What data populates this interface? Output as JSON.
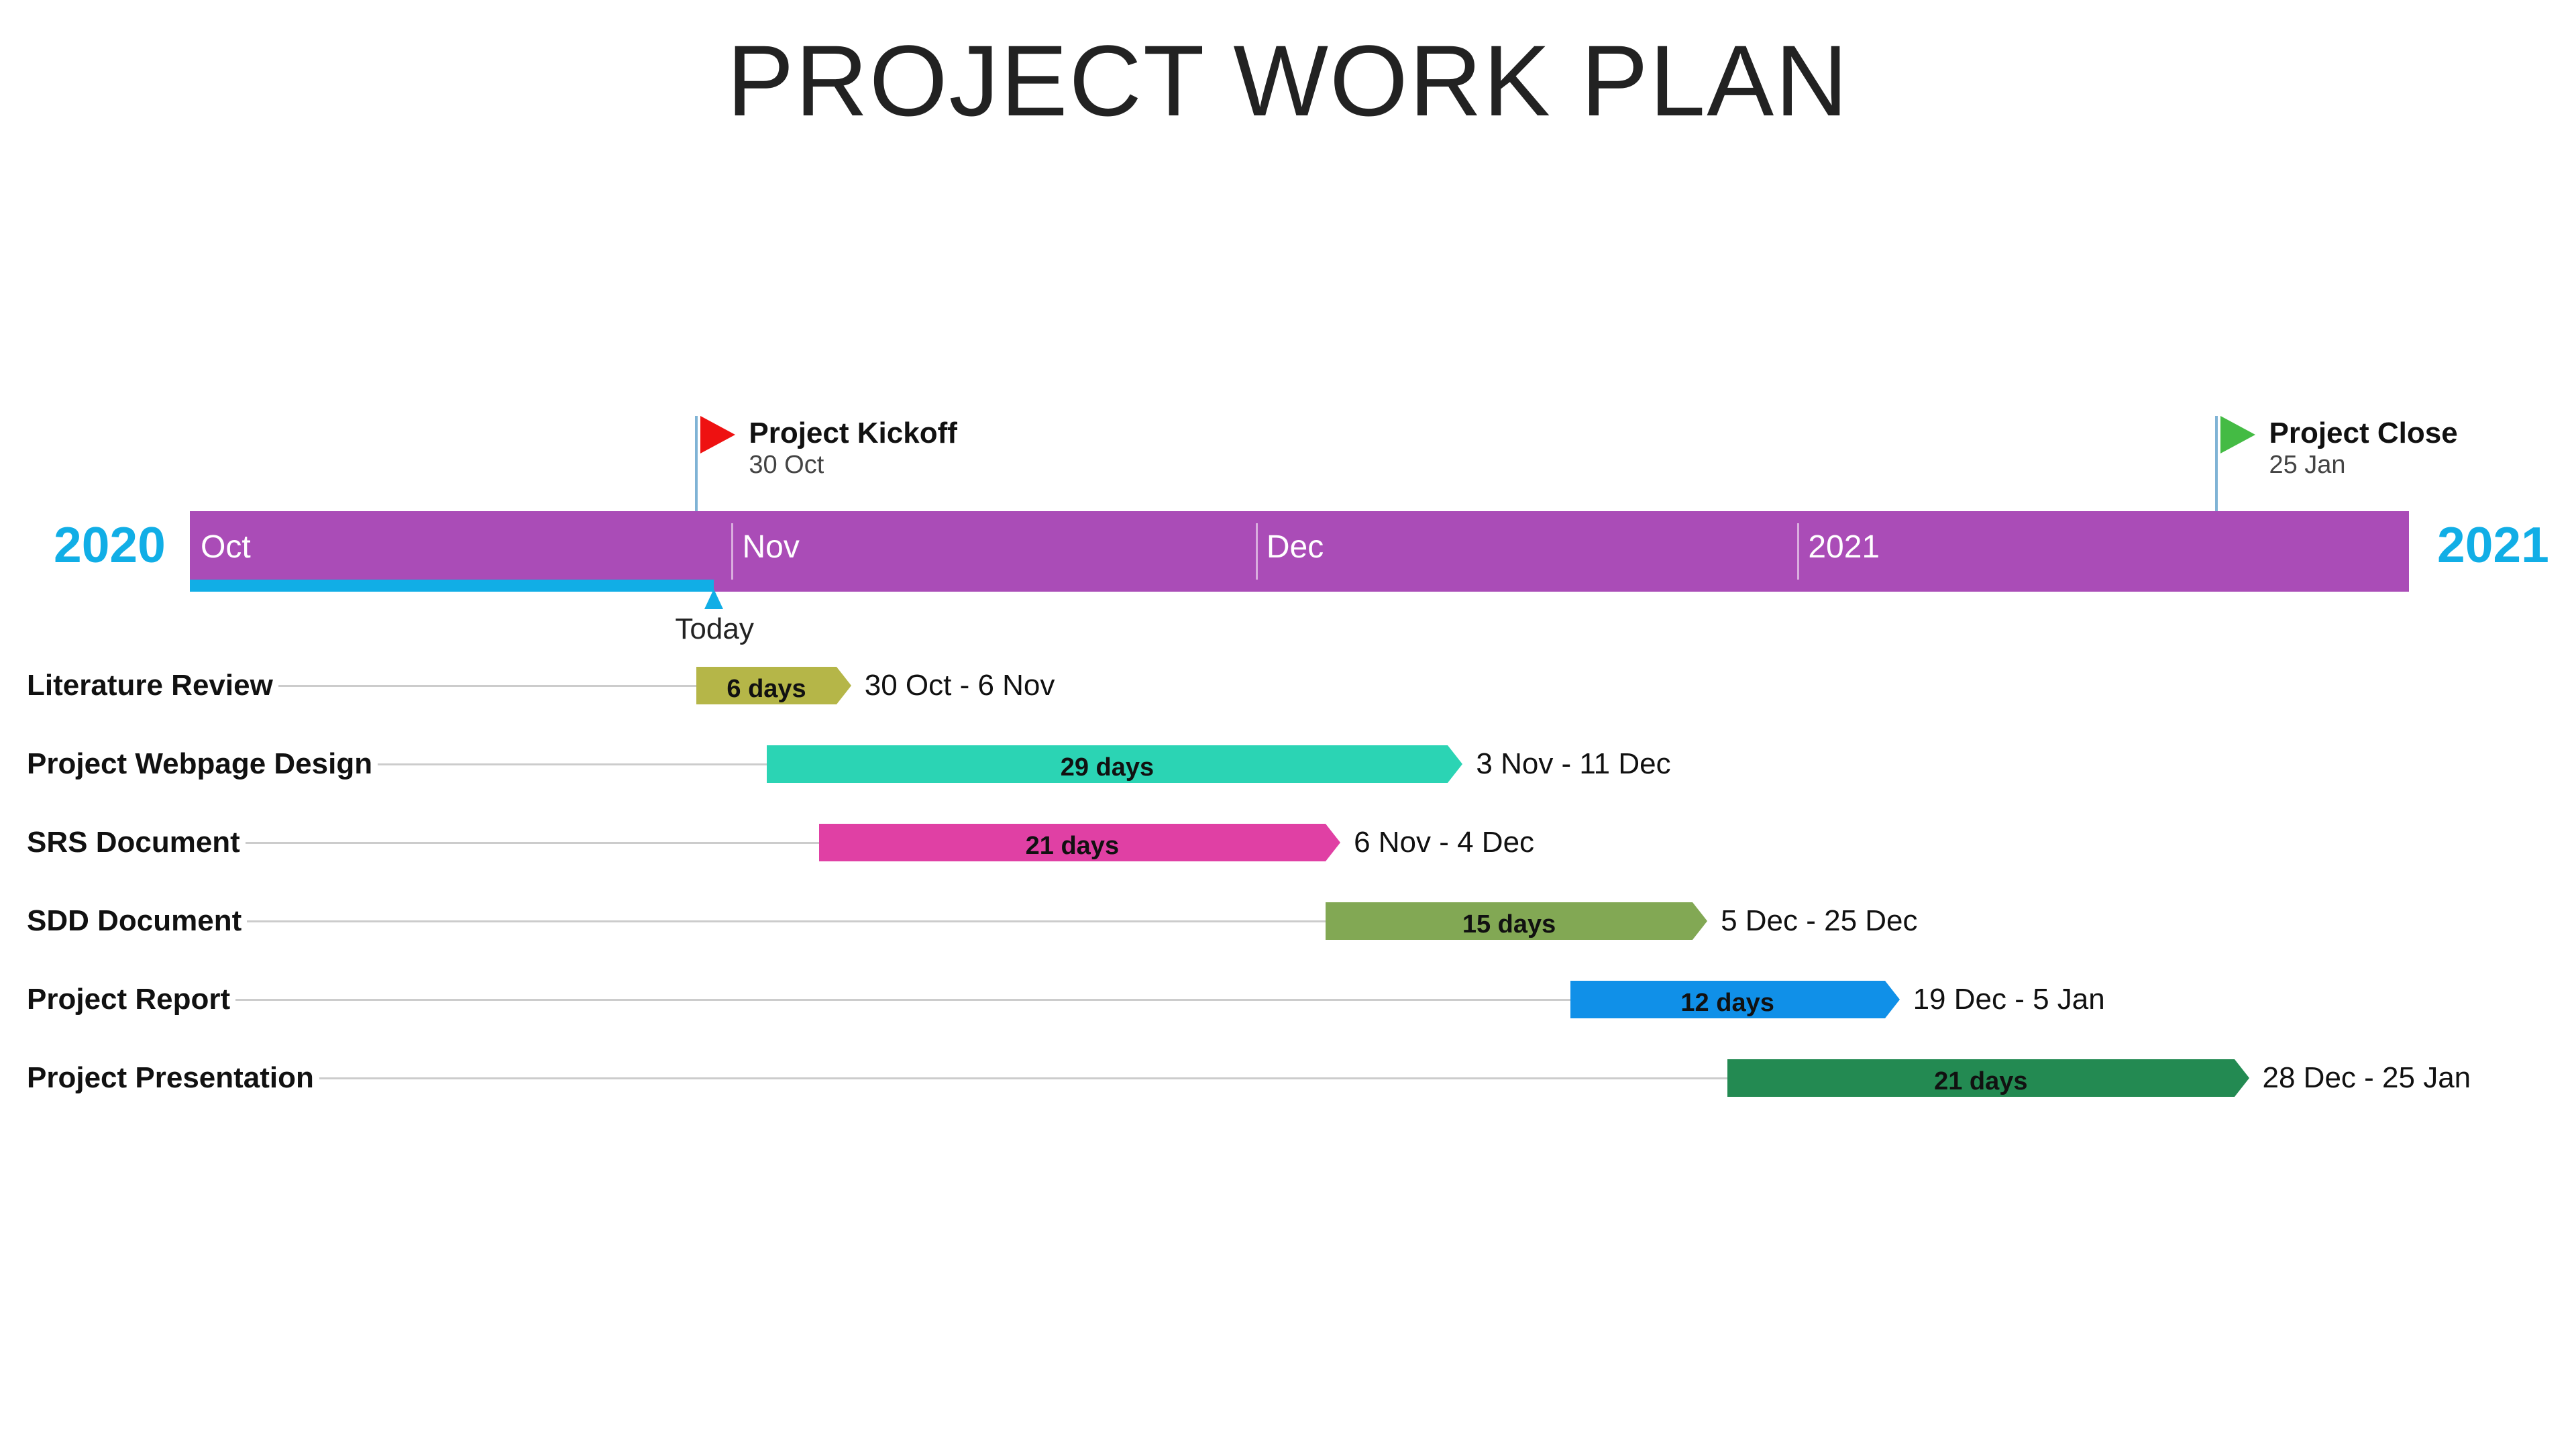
{
  "title": "PROJECT WORK PLAN",
  "colors": {
    "timeline": "#aa4cb7",
    "year_text": "#11aee6",
    "progress": "#11aee6",
    "today_marker": "#11aee6",
    "milestone_pole": "#7fb3d5"
  },
  "timeline": {
    "start_year_label": "2020",
    "end_year_label": "2021",
    "start_date": "2020-10-01",
    "end_date": "2021-02-05",
    "months": [
      {
        "label": "Oct",
        "date": "2020-10-01",
        "show_tick": false
      },
      {
        "label": "Nov",
        "date": "2020-11-01",
        "show_tick": true
      },
      {
        "label": "Dec",
        "date": "2020-12-01",
        "show_tick": true
      },
      {
        "label": "2021",
        "date": "2021-01-01",
        "show_tick": true
      }
    ],
    "today": {
      "label": "Today",
      "date": "2020-10-31"
    }
  },
  "milestones": [
    {
      "name": "Project Kickoff",
      "date_label": "30 Oct",
      "date": "2020-10-30",
      "flag_color": "#ee1111"
    },
    {
      "name": "Project Close",
      "date_label": "25 Jan",
      "date": "2021-01-25",
      "flag_color": "#44bb44"
    }
  ],
  "tasks": [
    {
      "name": "Literature Review",
      "duration_label": "6 days",
      "range_label": "30 Oct - 6 Nov",
      "start": "2020-10-30",
      "end": "2020-11-06",
      "color": "#b5b648"
    },
    {
      "name": "Project Webpage Design",
      "duration_label": "29 days",
      "range_label": "3 Nov - 11 Dec",
      "start": "2020-11-03",
      "end": "2020-12-11",
      "color": "#2bd4b4"
    },
    {
      "name": "SRS Document",
      "duration_label": "21 days",
      "range_label": "6 Nov - 4 Dec",
      "start": "2020-11-06",
      "end": "2020-12-04",
      "color": "#e040a4"
    },
    {
      "name": "SDD Document",
      "duration_label": "15 days",
      "range_label": "5 Dec - 25 Dec",
      "start": "2020-12-05",
      "end": "2020-12-25",
      "color": "#82a854"
    },
    {
      "name": "Project Report",
      "duration_label": "12 days",
      "range_label": "19 Dec - 5 Jan",
      "start": "2020-12-19",
      "end": "2021-01-05",
      "color": "#1090e8"
    },
    {
      "name": "Project Presentation",
      "duration_label": "21 days",
      "range_label": "28 Dec - 25 Jan",
      "start": "2020-12-28",
      "end": "2021-01-25",
      "color": "#238a52"
    }
  ]
}
